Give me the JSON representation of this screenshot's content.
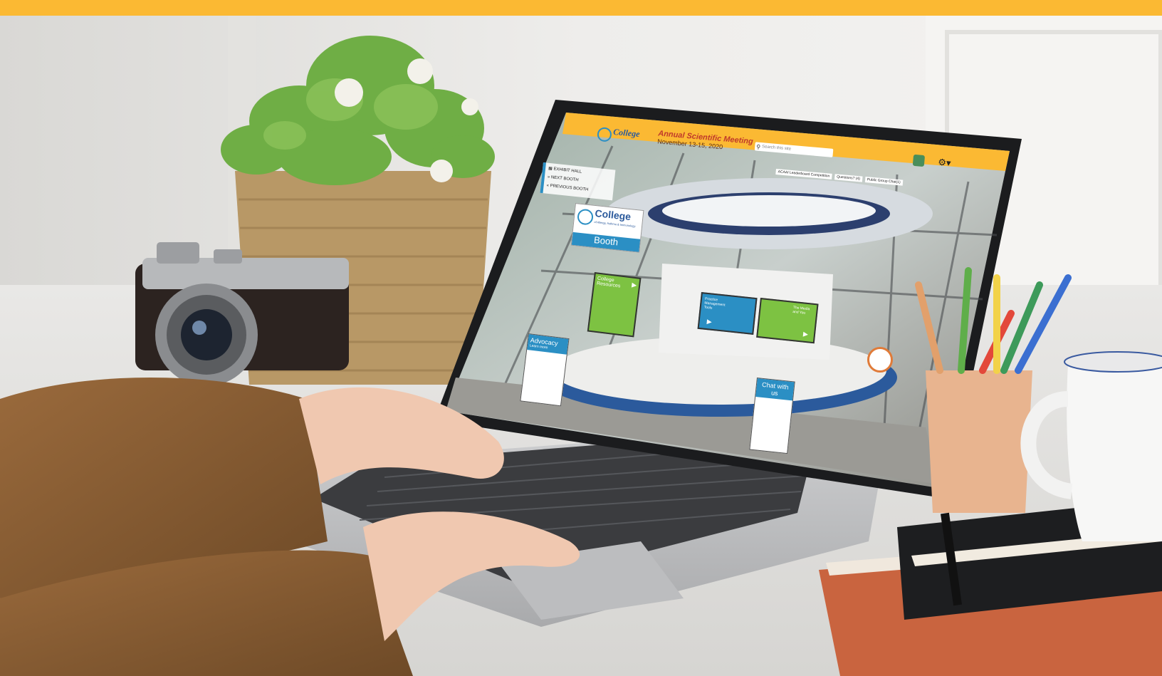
{
  "colors": {
    "accent": "#fbb933",
    "header_text": "#c0392b",
    "booth_blue": "#2b8fc4",
    "panel_green": "#7dc242"
  },
  "app": {
    "logo_text": "College",
    "meeting_title": "Annual Scientific Meeting",
    "meeting_dates": "November 13-15, 2020",
    "search_placeholder": "Search this site",
    "user_icon": "user-avatar-icon",
    "settings_icon": "gear-icon"
  },
  "toolbar": {
    "leaderboard": "ACAAI Leaderboard Competition",
    "questions": "Questions? (4)",
    "public_chat": "Public Group Chat(1)"
  },
  "nav": {
    "exhibit_hall": "EXHIBIT HALL",
    "next_booth": "NEXT BOOTH",
    "previous_booth": "PREVIOUS BOOTH"
  },
  "booth": {
    "sign_title": "College",
    "sign_subtitle": "of Allergy, Asthma & Immunology",
    "sign_label": "Booth",
    "panels": {
      "resources": "College Resources",
      "practice": "Practice Management Tools",
      "media": "The Media and You",
      "advocacy_title": "Advocacy",
      "advocacy_sub": "Learn more",
      "chat": "Chat with us"
    }
  }
}
